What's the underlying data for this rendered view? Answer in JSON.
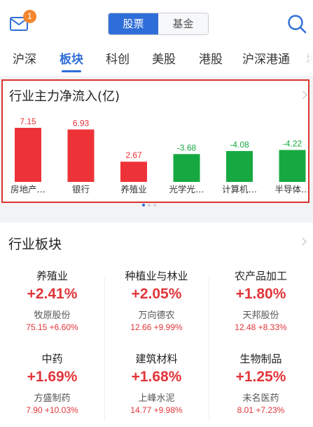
{
  "header": {
    "mail_badge": "1",
    "segments": [
      {
        "label": "股票",
        "active": true
      },
      {
        "label": "基金",
        "active": false
      }
    ]
  },
  "tabs": [
    {
      "label": "沪深",
      "active": false
    },
    {
      "label": "板块",
      "active": true
    },
    {
      "label": "科创",
      "active": false
    },
    {
      "label": "美股",
      "active": false
    },
    {
      "label": "港股",
      "active": false
    },
    {
      "label": "沪深港通",
      "active": false
    },
    {
      "label": "境",
      "active": false
    }
  ],
  "flow": {
    "title": "行业主力净流入(亿)"
  },
  "chart_data": {
    "type": "bar",
    "title": "行业主力净流入(亿)",
    "categories": [
      "房地产…",
      "银行",
      "养殖业",
      "光学光…",
      "计算机…",
      "半导体…"
    ],
    "values": [
      7.15,
      6.93,
      2.67,
      -3.68,
      -4.08,
      -4.22
    ],
    "value_labels": [
      "7.15",
      "6.93",
      "2.67",
      "-3.68",
      "-4.08",
      "-4.22"
    ],
    "colors": {
      "positive": "#ee3338",
      "negative": "#16a941"
    },
    "grid": false,
    "legend": "none"
  },
  "pager": {
    "pages": 3,
    "current": 1
  },
  "sector": {
    "title": "行业板块",
    "items": [
      {
        "name": "养殖业",
        "change": "+2.41%",
        "stock": "牧原股份",
        "quote": "75.15 +6.60%"
      },
      {
        "name": "种植业与林业",
        "change": "+2.05%",
        "stock": "万向德农",
        "quote": "12.66 +9.99%"
      },
      {
        "name": "农产品加工",
        "change": "+1.80%",
        "stock": "天邦股份",
        "quote": "12.48 +8.33%"
      },
      {
        "name": "中药",
        "change": "+1.69%",
        "stock": "方盛制药",
        "quote": "7.90 +10.03%"
      },
      {
        "name": "建筑材料",
        "change": "+1.68%",
        "stock": "上峰水泥",
        "quote": "14.77 +9.98%"
      },
      {
        "name": "生物制品",
        "change": "+1.25%",
        "stock": "未名医药",
        "quote": "8.01 +7.23%"
      }
    ],
    "up_color": "#e2353a"
  },
  "icons": [
    "mail-icon",
    "search-icon",
    "chevron-right-icon"
  ]
}
